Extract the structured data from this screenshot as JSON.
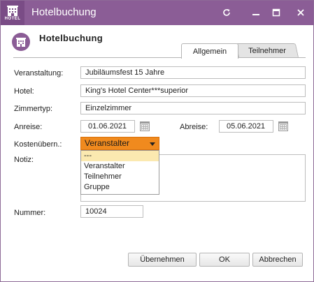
{
  "window": {
    "title": "Hotelbuchung",
    "app_icon_label": "HOTEL",
    "controls": [
      "refresh-icon",
      "minimize-icon",
      "maximize-icon",
      "close-icon"
    ]
  },
  "header": {
    "title": "Hotelbuchung"
  },
  "tabs": [
    {
      "label": "Allgemein",
      "active": true
    },
    {
      "label": "Teilnehmer",
      "active": false
    }
  ],
  "form": {
    "veranstaltung": {
      "label": "Veranstaltung:",
      "value": "Jubiläumsfest 15 Jahre"
    },
    "hotel": {
      "label": "Hotel:",
      "value": "King's Hotel Center***superior"
    },
    "zimmertyp": {
      "label": "Zimmertyp:",
      "value": "Einzelzimmer"
    },
    "anreise": {
      "label": "Anreise:",
      "value": "01.06.2021"
    },
    "abreise": {
      "label": "Abreise:",
      "value": "05.06.2021"
    },
    "kostenuebernahme": {
      "label": "Kostenübern.:",
      "selected": "Veranstalter",
      "options": [
        "---",
        "Veranstalter",
        "Teilnehmer",
        "Gruppe"
      ]
    },
    "notiz": {
      "label": "Notiz:",
      "value": ""
    },
    "nummer": {
      "label": "Nummer:",
      "value": "10024"
    }
  },
  "buttons": {
    "uebernehmen": "Übernehmen",
    "ok": "OK",
    "abbrechen": "Abbrechen"
  },
  "colors": {
    "titlebar": "#8b5d96",
    "select_accent": "#f08a1e",
    "dropdown_highlight": "#fbe9b0"
  }
}
